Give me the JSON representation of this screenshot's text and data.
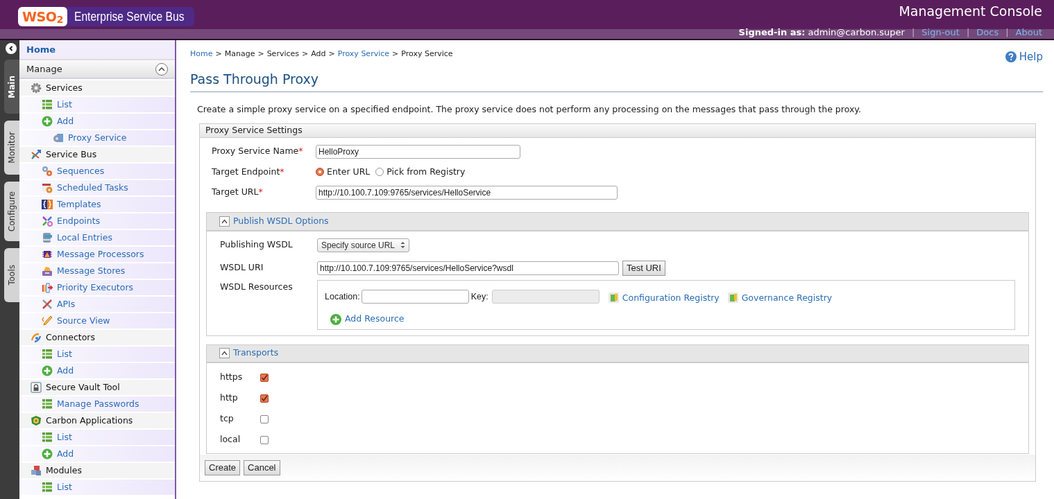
{
  "header": {
    "logo": "WSO$_{2}$",
    "product": "Enterprise Service Bus",
    "console_title": "Management Console",
    "signed_in_label": "Signed-in as:",
    "user": "admin@carbon.super",
    "links": [
      {
        "kind": "separator",
        "label": "|"
      },
      {
        "kind": "link",
        "label": "Sign-out"
      },
      {
        "kind": "separator",
        "label": "|"
      },
      {
        "kind": "link",
        "label": "Docs"
      },
      {
        "kind": "separator",
        "label": "|"
      },
      {
        "kind": "link",
        "label": "About"
      }
    ]
  },
  "side_tabs": [
    {
      "label": "Main",
      "selected": true
    },
    {
      "label": "Monitor",
      "selected": false
    },
    {
      "label": "Configure",
      "selected": false
    },
    {
      "label": "Tools",
      "selected": false
    }
  ],
  "sidebar": {
    "home": "Home",
    "section": {
      "label": "Manage",
      "expanded": true
    },
    "items": [
      {
        "label": "Services",
        "children": [
          {
            "label": "List"
          },
          {
            "label": "Add",
            "children": [
              {
                "label": "Proxy Service"
              }
            ]
          }
        ]
      },
      {
        "label": "Service Bus",
        "children": [
          {
            "label": "Sequences"
          },
          {
            "label": "Scheduled Tasks"
          },
          {
            "label": "Templates"
          },
          {
            "label": "Endpoints"
          },
          {
            "label": "Local Entries"
          },
          {
            "label": "Message Processors"
          },
          {
            "label": "Message Stores"
          },
          {
            "label": "Priority Executors"
          },
          {
            "label": "APIs"
          },
          {
            "label": "Source View"
          }
        ]
      },
      {
        "label": "Connectors",
        "children": [
          {
            "label": "List"
          },
          {
            "label": "Add"
          }
        ]
      },
      {
        "label": "Secure Vault Tool",
        "children": [
          {
            "label": "Manage Passwords"
          }
        ]
      },
      {
        "label": "Carbon Applications",
        "children": [
          {
            "label": "List"
          },
          {
            "label": "Add"
          }
        ]
      },
      {
        "label": "Modules",
        "children": [
          {
            "label": "List"
          }
        ]
      }
    ]
  },
  "breadcrumb": [
    {
      "kind": "link",
      "label": "Home"
    },
    {
      "kind": "separator",
      "label": ">"
    },
    {
      "kind": "text",
      "label": "Manage"
    },
    {
      "kind": "separator",
      "label": ">"
    },
    {
      "kind": "text",
      "label": "Services"
    },
    {
      "kind": "separator",
      "label": ">"
    },
    {
      "kind": "text",
      "label": "Add"
    },
    {
      "kind": "separator",
      "label": ">"
    },
    {
      "kind": "link",
      "label": "Proxy Service"
    },
    {
      "kind": "separator",
      "label": ">"
    },
    {
      "kind": "text",
      "label": "Proxy Service"
    }
  ],
  "help": "Help",
  "page_title": "Pass Through Proxy",
  "description": "Create a simple proxy service on a specified endpoint. The proxy service does not perform any processing on the messages that pass through the proxy.",
  "settings": {
    "title": "Proxy Service Settings",
    "required_mark": "*",
    "name": {
      "label": "Proxy Service Name",
      "value": "HelloProxy"
    },
    "target_endpoint": {
      "label": "Target Endpoint",
      "options": [
        {
          "label": "Enter URL",
          "selected": true
        },
        {
          "label": "Pick from Registry",
          "selected": false
        }
      ]
    },
    "target_url": {
      "label": "Target URL",
      "value": "http://10.100.7.109:9765/services/HelloService"
    }
  },
  "wsdl": {
    "title": "Publish WSDL Options",
    "expanded": true,
    "publishing": {
      "label": "Publishing WSDL",
      "value": "Specify source URL"
    },
    "uri": {
      "label": "WSDL URI",
      "value": "http://10.100.7.109:9765/services/HelloService?wsdl",
      "button": "Test URI"
    },
    "resources": {
      "label": "WSDL Resources",
      "location_label": "Location:",
      "key_label": "Key:",
      "registry_links": [
        "Configuration Registry",
        "Governance Registry"
      ],
      "add": "Add Resource"
    }
  },
  "transports": {
    "title": "Transports",
    "expanded": true,
    "items": [
      {
        "label": "https",
        "checked": true
      },
      {
        "label": "http",
        "checked": true
      },
      {
        "label": "tcp",
        "checked": false
      },
      {
        "label": "local",
        "checked": false
      }
    ]
  },
  "buttons": [
    "Create",
    "Cancel"
  ]
}
